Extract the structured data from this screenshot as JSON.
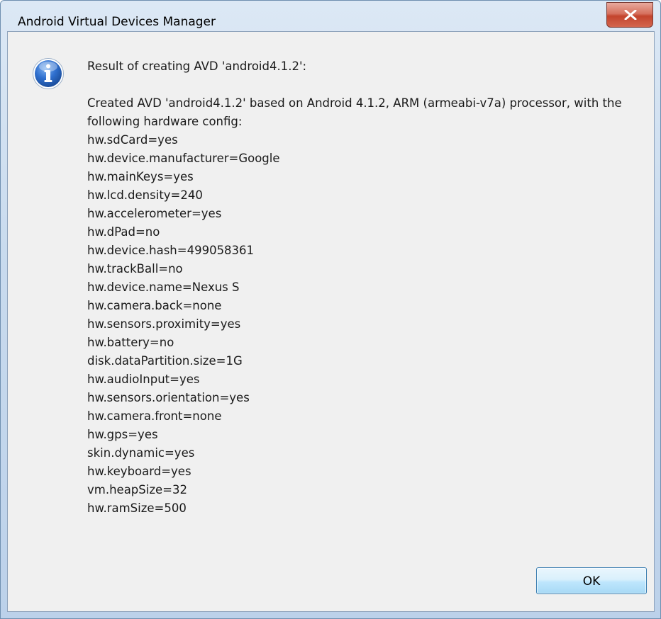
{
  "window": {
    "title": "Android Virtual Devices Manager",
    "close_icon": "close-x-icon",
    "accent_close": "#c3442d"
  },
  "dialog": {
    "icon": "info-icon",
    "icon_color": "#2a66c4",
    "heading": "Result of creating AVD 'android4.1.2':",
    "summary": "Created AVD 'android4.1.2' based on Android 4.1.2, ARM (armeabi-v7a) processor, with the following hardware config:",
    "config": [
      "hw.sdCard=yes",
      "hw.device.manufacturer=Google",
      "hw.mainKeys=yes",
      "hw.lcd.density=240",
      "hw.accelerometer=yes",
      "hw.dPad=no",
      "hw.device.hash=499058361",
      "hw.trackBall=no",
      "hw.device.name=Nexus S",
      "hw.camera.back=none",
      "hw.sensors.proximity=yes",
      "hw.battery=no",
      "disk.dataPartition.size=1G",
      "hw.audioInput=yes",
      "hw.sensors.orientation=yes",
      "hw.camera.front=none",
      "hw.gps=yes",
      "skin.dynamic=yes",
      "hw.keyboard=yes",
      "vm.heapSize=32",
      "hw.ramSize=500"
    ],
    "ok_label": "OK"
  }
}
